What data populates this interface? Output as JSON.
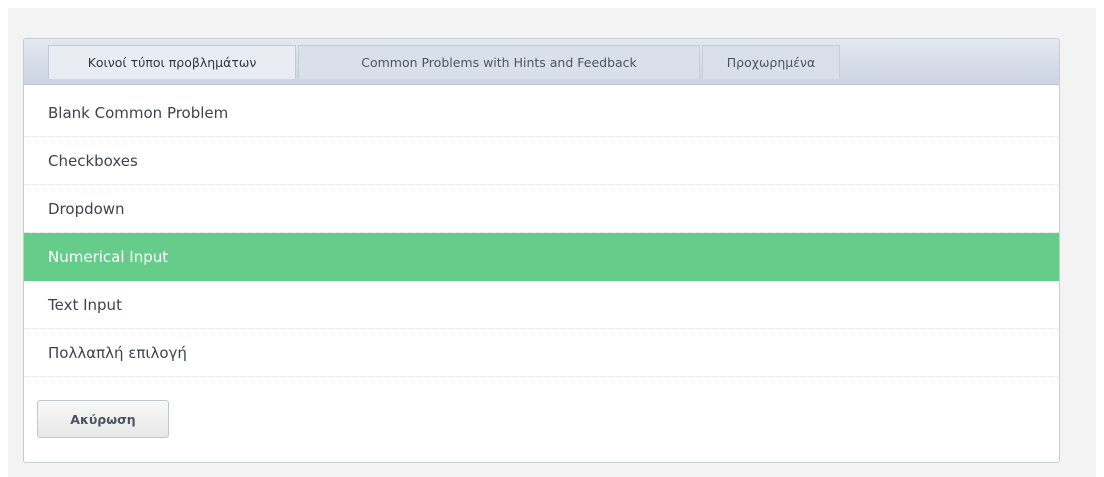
{
  "tabs": [
    {
      "label": "Κοινοί τύποι προβλημάτων",
      "active": true
    },
    {
      "label": "Common Problems with Hints and Feedback",
      "active": false
    },
    {
      "label": "Προχωρημένα",
      "active": false
    }
  ],
  "problems": [
    {
      "label": "Blank Common Problem"
    },
    {
      "label": "Checkboxes"
    },
    {
      "label": "Dropdown"
    },
    {
      "label": "Numerical Input",
      "selected": true
    },
    {
      "label": "Text Input"
    },
    {
      "label": "Πολλαπλή επιλογή"
    }
  ],
  "actions": {
    "cancel_label": "Ακύρωση"
  },
  "colors": {
    "selected_row": "#66cc8a",
    "tabbar": "#cdd5e2"
  }
}
